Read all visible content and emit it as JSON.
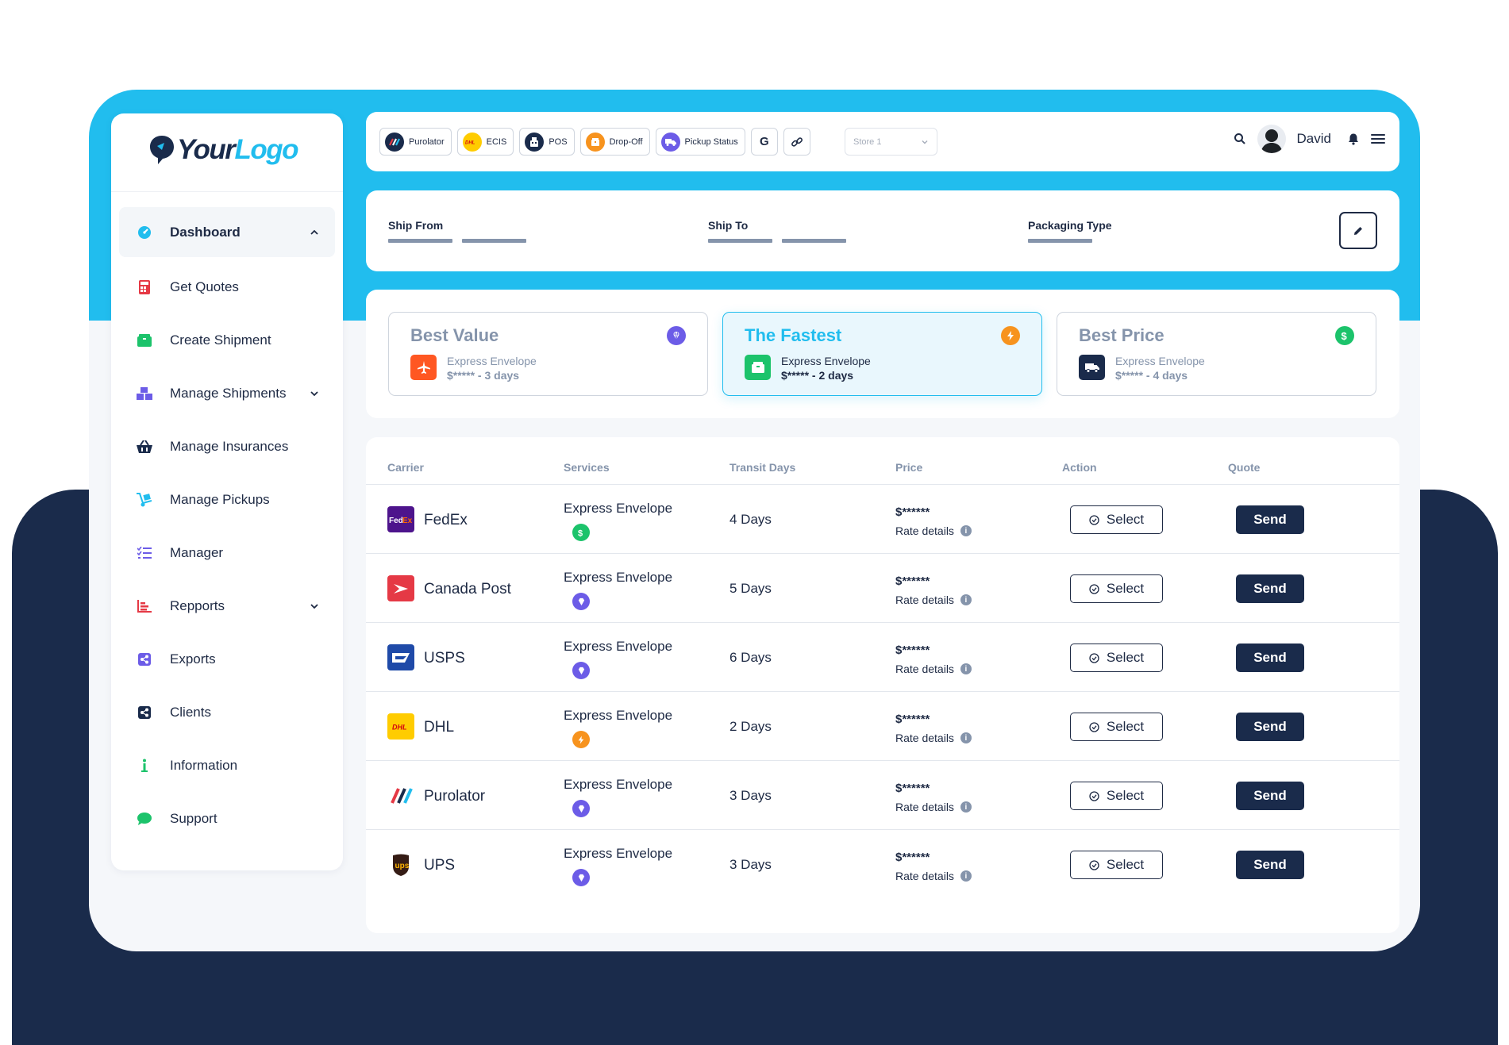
{
  "brand": {
    "logo_part1": "Your",
    "logo_part2": "Logo"
  },
  "colors": {
    "accent": "#21bdee",
    "navy": "#1a2b4b",
    "value": "#6c5ce7",
    "fast": "#f7931e",
    "price": "#1cc36b"
  },
  "sidebar": {
    "items": [
      {
        "label": "Dashboard",
        "icon": "dashboard-icon",
        "color": "#21bdee"
      },
      {
        "label": "Get Quotes",
        "icon": "calculator-icon",
        "color": "#e53945"
      },
      {
        "label": "Create Shipment",
        "icon": "box-icon",
        "color": "#1cc36b"
      },
      {
        "label": "Manage Shipments",
        "icon": "boxes-icon",
        "color": "#6c5ce7"
      },
      {
        "label": "Manage Insurances",
        "icon": "basket-icon",
        "color": "#1a2b4b"
      },
      {
        "label": "Manage Pickups",
        "icon": "dolly-icon",
        "color": "#21bdee"
      },
      {
        "label": "Manager",
        "icon": "checklist-icon",
        "color": "#6c5ce7"
      },
      {
        "label": "Repports",
        "icon": "chart-icon",
        "color": "#e53945"
      },
      {
        "label": "Exports",
        "icon": "export-icon",
        "color": "#6c5ce7"
      },
      {
        "label": "Clients",
        "icon": "share-icon",
        "color": "#1a2b4b"
      },
      {
        "label": "Information",
        "icon": "info-icon",
        "color": "#1cc36b"
      },
      {
        "label": "Support",
        "icon": "chat-icon",
        "color": "#1cc36b"
      }
    ]
  },
  "topbar": {
    "chips": [
      {
        "label": "Purolator",
        "icon": "purolator-icon"
      },
      {
        "label": "ECIS",
        "icon": "dhl-icon"
      },
      {
        "label": "POS",
        "icon": "pos-icon"
      },
      {
        "label": "Drop-Off",
        "icon": "dropoff-icon"
      },
      {
        "label": "Pickup Status",
        "icon": "truck-icon"
      }
    ],
    "store_placeholder": "Store 1",
    "user_name": "David"
  },
  "shipbar": {
    "ship_from": "Ship From",
    "ship_to": "Ship To",
    "packaging_type": "Packaging Type"
  },
  "best": [
    {
      "title": "Best Value",
      "service": "Express Envelope",
      "sub": "$***** - 3 days"
    },
    {
      "title": "The Fastest",
      "service": "Express Envelope",
      "sub": "$***** - 2 days"
    },
    {
      "title": "Best Price",
      "service": "Express Envelope",
      "sub": "$***** - 4 days"
    }
  ],
  "table": {
    "headers": [
      "Carrier",
      "Services",
      "Transit Days",
      "Price",
      "Action",
      "Quote"
    ],
    "rows": [
      {
        "carrier": "FedEx",
        "service": "Express Envelope",
        "badge": "price",
        "days": "4 Days",
        "price": "$******",
        "rate": "Rate details",
        "action": "Select",
        "quote": "Send"
      },
      {
        "carrier": "Canada Post",
        "service": "Express Envelope",
        "badge": "value",
        "days": "5 Days",
        "price": "$******",
        "rate": "Rate details",
        "action": "Select",
        "quote": "Send"
      },
      {
        "carrier": "USPS",
        "service": "Express Envelope",
        "badge": "value",
        "days": "6 Days",
        "price": "$******",
        "rate": "Rate details",
        "action": "Select",
        "quote": "Send"
      },
      {
        "carrier": "DHL",
        "service": "Express Envelope",
        "badge": "fast",
        "days": "2 Days",
        "price": "$******",
        "rate": "Rate details",
        "action": "Select",
        "quote": "Send"
      },
      {
        "carrier": "Purolator",
        "service": "Express Envelope",
        "badge": "value",
        "days": "3 Days",
        "price": "$******",
        "rate": "Rate details",
        "action": "Select",
        "quote": "Send"
      },
      {
        "carrier": "UPS",
        "service": "Express Envelope",
        "badge": "value",
        "days": "3 Days",
        "price": "$******",
        "rate": "Rate details",
        "action": "Select",
        "quote": "Send"
      }
    ]
  }
}
